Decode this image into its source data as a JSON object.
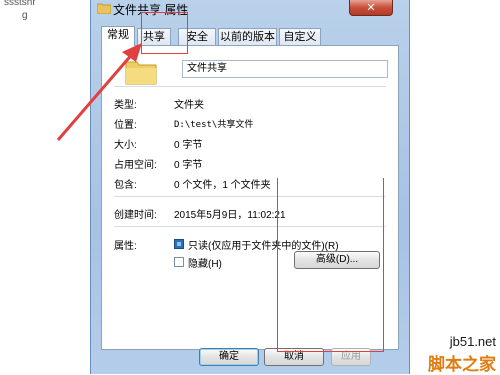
{
  "background": {
    "text_line1": "ssstshr",
    "text_line2": "g"
  },
  "window": {
    "title": "文件共享 属性",
    "close_label": "✕"
  },
  "tabs": [
    {
      "label": "常规",
      "active": true
    },
    {
      "label": "共享",
      "active": false
    },
    {
      "label": "安全",
      "active": false
    },
    {
      "label": "以前的版本",
      "active": false
    },
    {
      "label": "自定义",
      "active": false
    }
  ],
  "general": {
    "name_value": "文件共享",
    "type_label": "类型:",
    "type_value": "文件夹",
    "location_label": "位置:",
    "location_value": "D:\\test\\共享文件",
    "size_label": "大小:",
    "size_value": "0 字节",
    "disk_label": "占用空间:",
    "disk_value": "0 字节",
    "contains_label": "包含:",
    "contains_value": "0 个文件，1 个文件夹",
    "created_label": "创建时间:",
    "created_value": "2015年5月9日，11:02:21",
    "attributes_label": "属性:",
    "readonly_label": "只读(仅应用于文件夹中的文件)(R)",
    "readonly_checked": true,
    "hidden_label": "隐藏(H)",
    "hidden_checked": false,
    "advanced_label": "高级(D)..."
  },
  "buttons": {
    "ok": "确定",
    "cancel": "取消",
    "apply": "应用"
  },
  "watermark": {
    "url": "jb51.net",
    "name": "脚本之家"
  },
  "colors": {
    "annotation": "#e04040",
    "brand_orange": "#f39c12"
  }
}
